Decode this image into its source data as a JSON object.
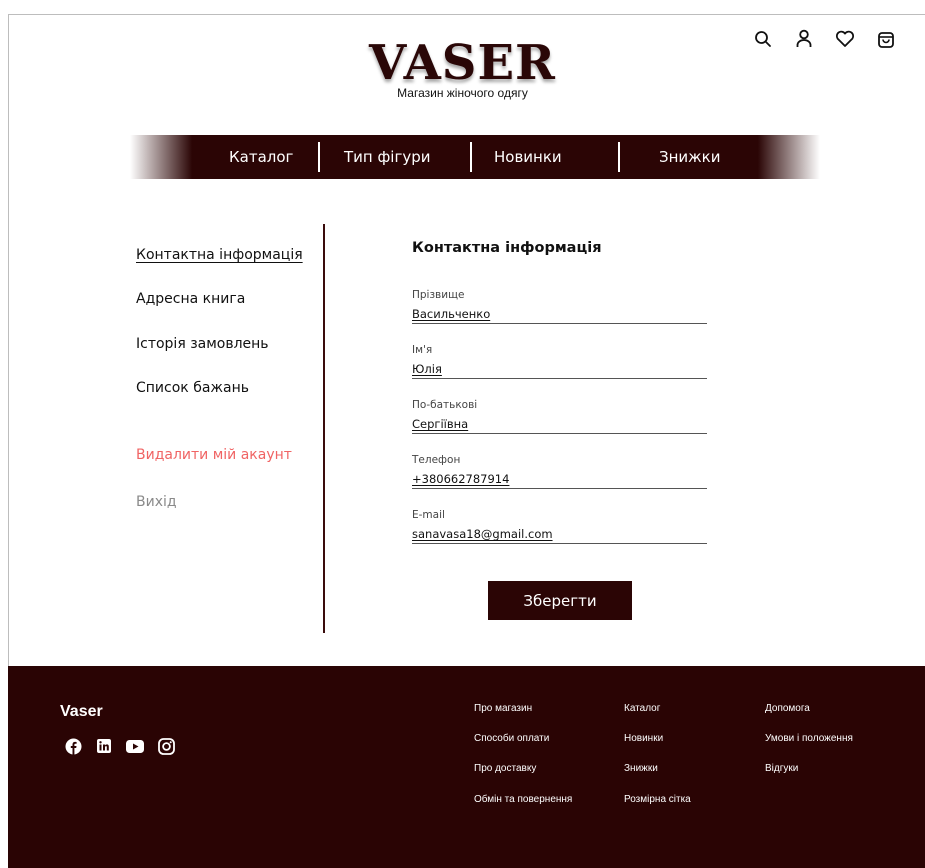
{
  "header": {
    "logo": "VASER",
    "tagline": "Магазин жіночого одягу",
    "icons": [
      "search-icon",
      "user-icon",
      "heart-icon",
      "cart-icon"
    ]
  },
  "nav": {
    "items": [
      {
        "label": "Каталог"
      },
      {
        "label": "Тип фігури"
      },
      {
        "label": "Новинки"
      },
      {
        "label": "Знижки"
      }
    ]
  },
  "sidebar": {
    "items": [
      {
        "label": "Контактна інформація"
      },
      {
        "label": "Адресна книга"
      },
      {
        "label": "Історія замовлень"
      },
      {
        "label": "Список бажань"
      },
      {
        "label": "Видалити мій акаунт"
      },
      {
        "label": "Вихід"
      }
    ]
  },
  "form": {
    "title": "Контактна інформація",
    "fields": [
      {
        "label": "Прізвище",
        "value": "Васильченко"
      },
      {
        "label": "Ім'я",
        "value": "Юлія"
      },
      {
        "label": "По-батькові",
        "value": "Сергіївна"
      },
      {
        "label": "Телефон",
        "value": "+380662787914"
      },
      {
        "label": "E-mail",
        "value": "sanavasa18@gmail.com"
      }
    ],
    "save_label": "Зберегти"
  },
  "footer": {
    "brand": "Vaser",
    "socials": [
      "facebook-icon",
      "linkedin-icon",
      "youtube-icon",
      "instagram-icon"
    ],
    "columns": [
      [
        "Про магазин",
        "Способи оплати",
        "Про доставку",
        "Обмін та повернення"
      ],
      [
        "Каталог",
        "Новинки",
        "Знижки",
        "Розмірна сітка"
      ],
      [
        "Допомога",
        "Умови і положення",
        "Відгуки"
      ]
    ]
  },
  "colors": {
    "brand_dark": "#2b0505",
    "danger": "#f06464",
    "muted": "#8a8a8a"
  }
}
